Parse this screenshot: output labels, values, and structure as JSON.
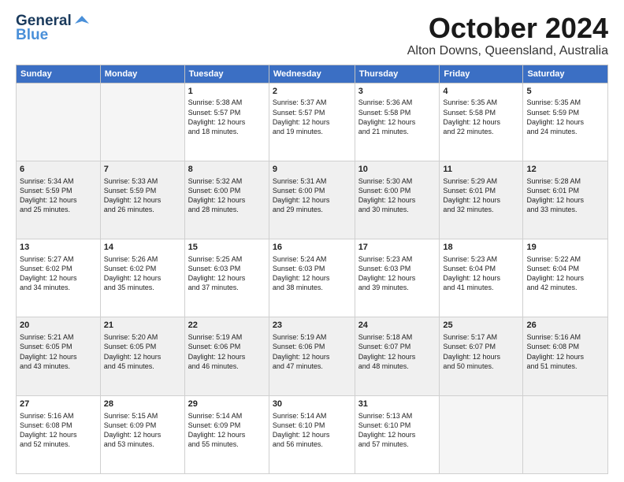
{
  "header": {
    "logo_line1": "General",
    "logo_line2": "Blue",
    "month": "October 2024",
    "location": "Alton Downs, Queensland, Australia"
  },
  "days_of_week": [
    "Sunday",
    "Monday",
    "Tuesday",
    "Wednesday",
    "Thursday",
    "Friday",
    "Saturday"
  ],
  "weeks": [
    [
      {
        "day": "",
        "info": ""
      },
      {
        "day": "",
        "info": ""
      },
      {
        "day": "1",
        "info": "Sunrise: 5:38 AM\nSunset: 5:57 PM\nDaylight: 12 hours\nand 18 minutes."
      },
      {
        "day": "2",
        "info": "Sunrise: 5:37 AM\nSunset: 5:57 PM\nDaylight: 12 hours\nand 19 minutes."
      },
      {
        "day": "3",
        "info": "Sunrise: 5:36 AM\nSunset: 5:58 PM\nDaylight: 12 hours\nand 21 minutes."
      },
      {
        "day": "4",
        "info": "Sunrise: 5:35 AM\nSunset: 5:58 PM\nDaylight: 12 hours\nand 22 minutes."
      },
      {
        "day": "5",
        "info": "Sunrise: 5:35 AM\nSunset: 5:59 PM\nDaylight: 12 hours\nand 24 minutes."
      }
    ],
    [
      {
        "day": "6",
        "info": "Sunrise: 5:34 AM\nSunset: 5:59 PM\nDaylight: 12 hours\nand 25 minutes."
      },
      {
        "day": "7",
        "info": "Sunrise: 5:33 AM\nSunset: 5:59 PM\nDaylight: 12 hours\nand 26 minutes."
      },
      {
        "day": "8",
        "info": "Sunrise: 5:32 AM\nSunset: 6:00 PM\nDaylight: 12 hours\nand 28 minutes."
      },
      {
        "day": "9",
        "info": "Sunrise: 5:31 AM\nSunset: 6:00 PM\nDaylight: 12 hours\nand 29 minutes."
      },
      {
        "day": "10",
        "info": "Sunrise: 5:30 AM\nSunset: 6:00 PM\nDaylight: 12 hours\nand 30 minutes."
      },
      {
        "day": "11",
        "info": "Sunrise: 5:29 AM\nSunset: 6:01 PM\nDaylight: 12 hours\nand 32 minutes."
      },
      {
        "day": "12",
        "info": "Sunrise: 5:28 AM\nSunset: 6:01 PM\nDaylight: 12 hours\nand 33 minutes."
      }
    ],
    [
      {
        "day": "13",
        "info": "Sunrise: 5:27 AM\nSunset: 6:02 PM\nDaylight: 12 hours\nand 34 minutes."
      },
      {
        "day": "14",
        "info": "Sunrise: 5:26 AM\nSunset: 6:02 PM\nDaylight: 12 hours\nand 35 minutes."
      },
      {
        "day": "15",
        "info": "Sunrise: 5:25 AM\nSunset: 6:03 PM\nDaylight: 12 hours\nand 37 minutes."
      },
      {
        "day": "16",
        "info": "Sunrise: 5:24 AM\nSunset: 6:03 PM\nDaylight: 12 hours\nand 38 minutes."
      },
      {
        "day": "17",
        "info": "Sunrise: 5:23 AM\nSunset: 6:03 PM\nDaylight: 12 hours\nand 39 minutes."
      },
      {
        "day": "18",
        "info": "Sunrise: 5:23 AM\nSunset: 6:04 PM\nDaylight: 12 hours\nand 41 minutes."
      },
      {
        "day": "19",
        "info": "Sunrise: 5:22 AM\nSunset: 6:04 PM\nDaylight: 12 hours\nand 42 minutes."
      }
    ],
    [
      {
        "day": "20",
        "info": "Sunrise: 5:21 AM\nSunset: 6:05 PM\nDaylight: 12 hours\nand 43 minutes."
      },
      {
        "day": "21",
        "info": "Sunrise: 5:20 AM\nSunset: 6:05 PM\nDaylight: 12 hours\nand 45 minutes."
      },
      {
        "day": "22",
        "info": "Sunrise: 5:19 AM\nSunset: 6:06 PM\nDaylight: 12 hours\nand 46 minutes."
      },
      {
        "day": "23",
        "info": "Sunrise: 5:19 AM\nSunset: 6:06 PM\nDaylight: 12 hours\nand 47 minutes."
      },
      {
        "day": "24",
        "info": "Sunrise: 5:18 AM\nSunset: 6:07 PM\nDaylight: 12 hours\nand 48 minutes."
      },
      {
        "day": "25",
        "info": "Sunrise: 5:17 AM\nSunset: 6:07 PM\nDaylight: 12 hours\nand 50 minutes."
      },
      {
        "day": "26",
        "info": "Sunrise: 5:16 AM\nSunset: 6:08 PM\nDaylight: 12 hours\nand 51 minutes."
      }
    ],
    [
      {
        "day": "27",
        "info": "Sunrise: 5:16 AM\nSunset: 6:08 PM\nDaylight: 12 hours\nand 52 minutes."
      },
      {
        "day": "28",
        "info": "Sunrise: 5:15 AM\nSunset: 6:09 PM\nDaylight: 12 hours\nand 53 minutes."
      },
      {
        "day": "29",
        "info": "Sunrise: 5:14 AM\nSunset: 6:09 PM\nDaylight: 12 hours\nand 55 minutes."
      },
      {
        "day": "30",
        "info": "Sunrise: 5:14 AM\nSunset: 6:10 PM\nDaylight: 12 hours\nand 56 minutes."
      },
      {
        "day": "31",
        "info": "Sunrise: 5:13 AM\nSunset: 6:10 PM\nDaylight: 12 hours\nand 57 minutes."
      },
      {
        "day": "",
        "info": ""
      },
      {
        "day": "",
        "info": ""
      }
    ]
  ]
}
